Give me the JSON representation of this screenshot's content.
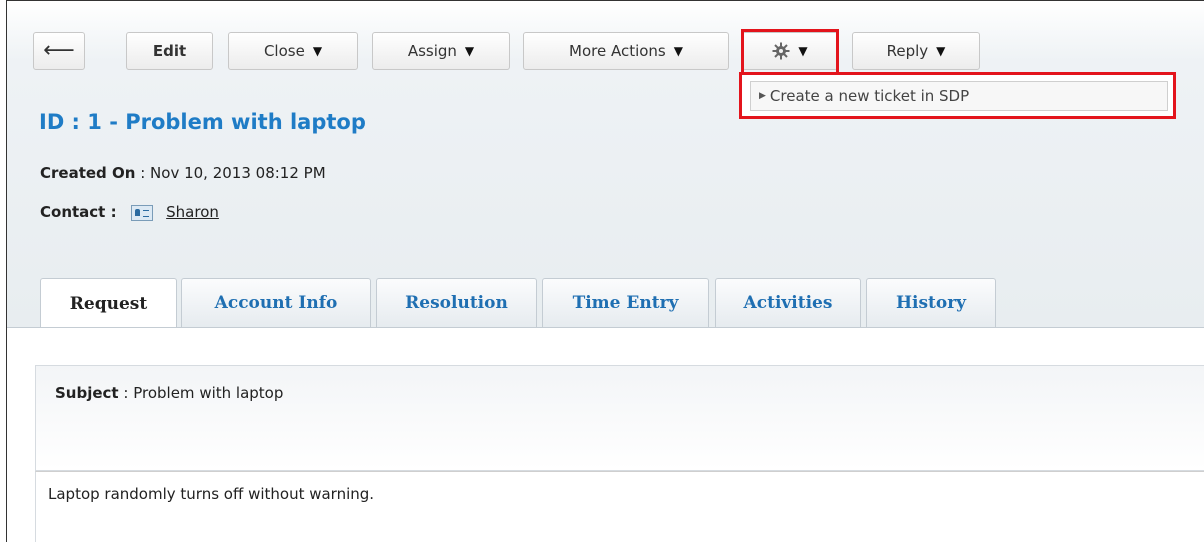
{
  "toolbar": {
    "back_icon": "back-arrow-icon",
    "edit_label": "Edit",
    "close_label": "Close",
    "assign_label": "Assign",
    "more_actions_label": "More Actions",
    "gear_icon": "gear-icon",
    "reply_label": "Reply",
    "caret_glyph": "▼"
  },
  "gear_menu": {
    "items": [
      {
        "label": "Create a new ticket in SDP"
      }
    ]
  },
  "ticket": {
    "title": "ID : 1 - Problem with laptop",
    "created_on_label": "Created On",
    "created_on_value": "Nov 10, 2013 08:12 PM",
    "contact_label": "Contact :",
    "contact_name": "Sharon"
  },
  "tabs": [
    {
      "label": "Request",
      "active": true
    },
    {
      "label": "Account Info",
      "active": false
    },
    {
      "label": "Resolution",
      "active": false
    },
    {
      "label": "Time Entry",
      "active": false
    },
    {
      "label": "Activities",
      "active": false
    },
    {
      "label": "History",
      "active": false
    }
  ],
  "request": {
    "subject_label": "Subject",
    "subject_value": "Problem with laptop",
    "description": "Laptop randomly turns off without warning."
  },
  "colors": {
    "highlight": "#e3141c",
    "link_blue": "#1f7cc6"
  }
}
